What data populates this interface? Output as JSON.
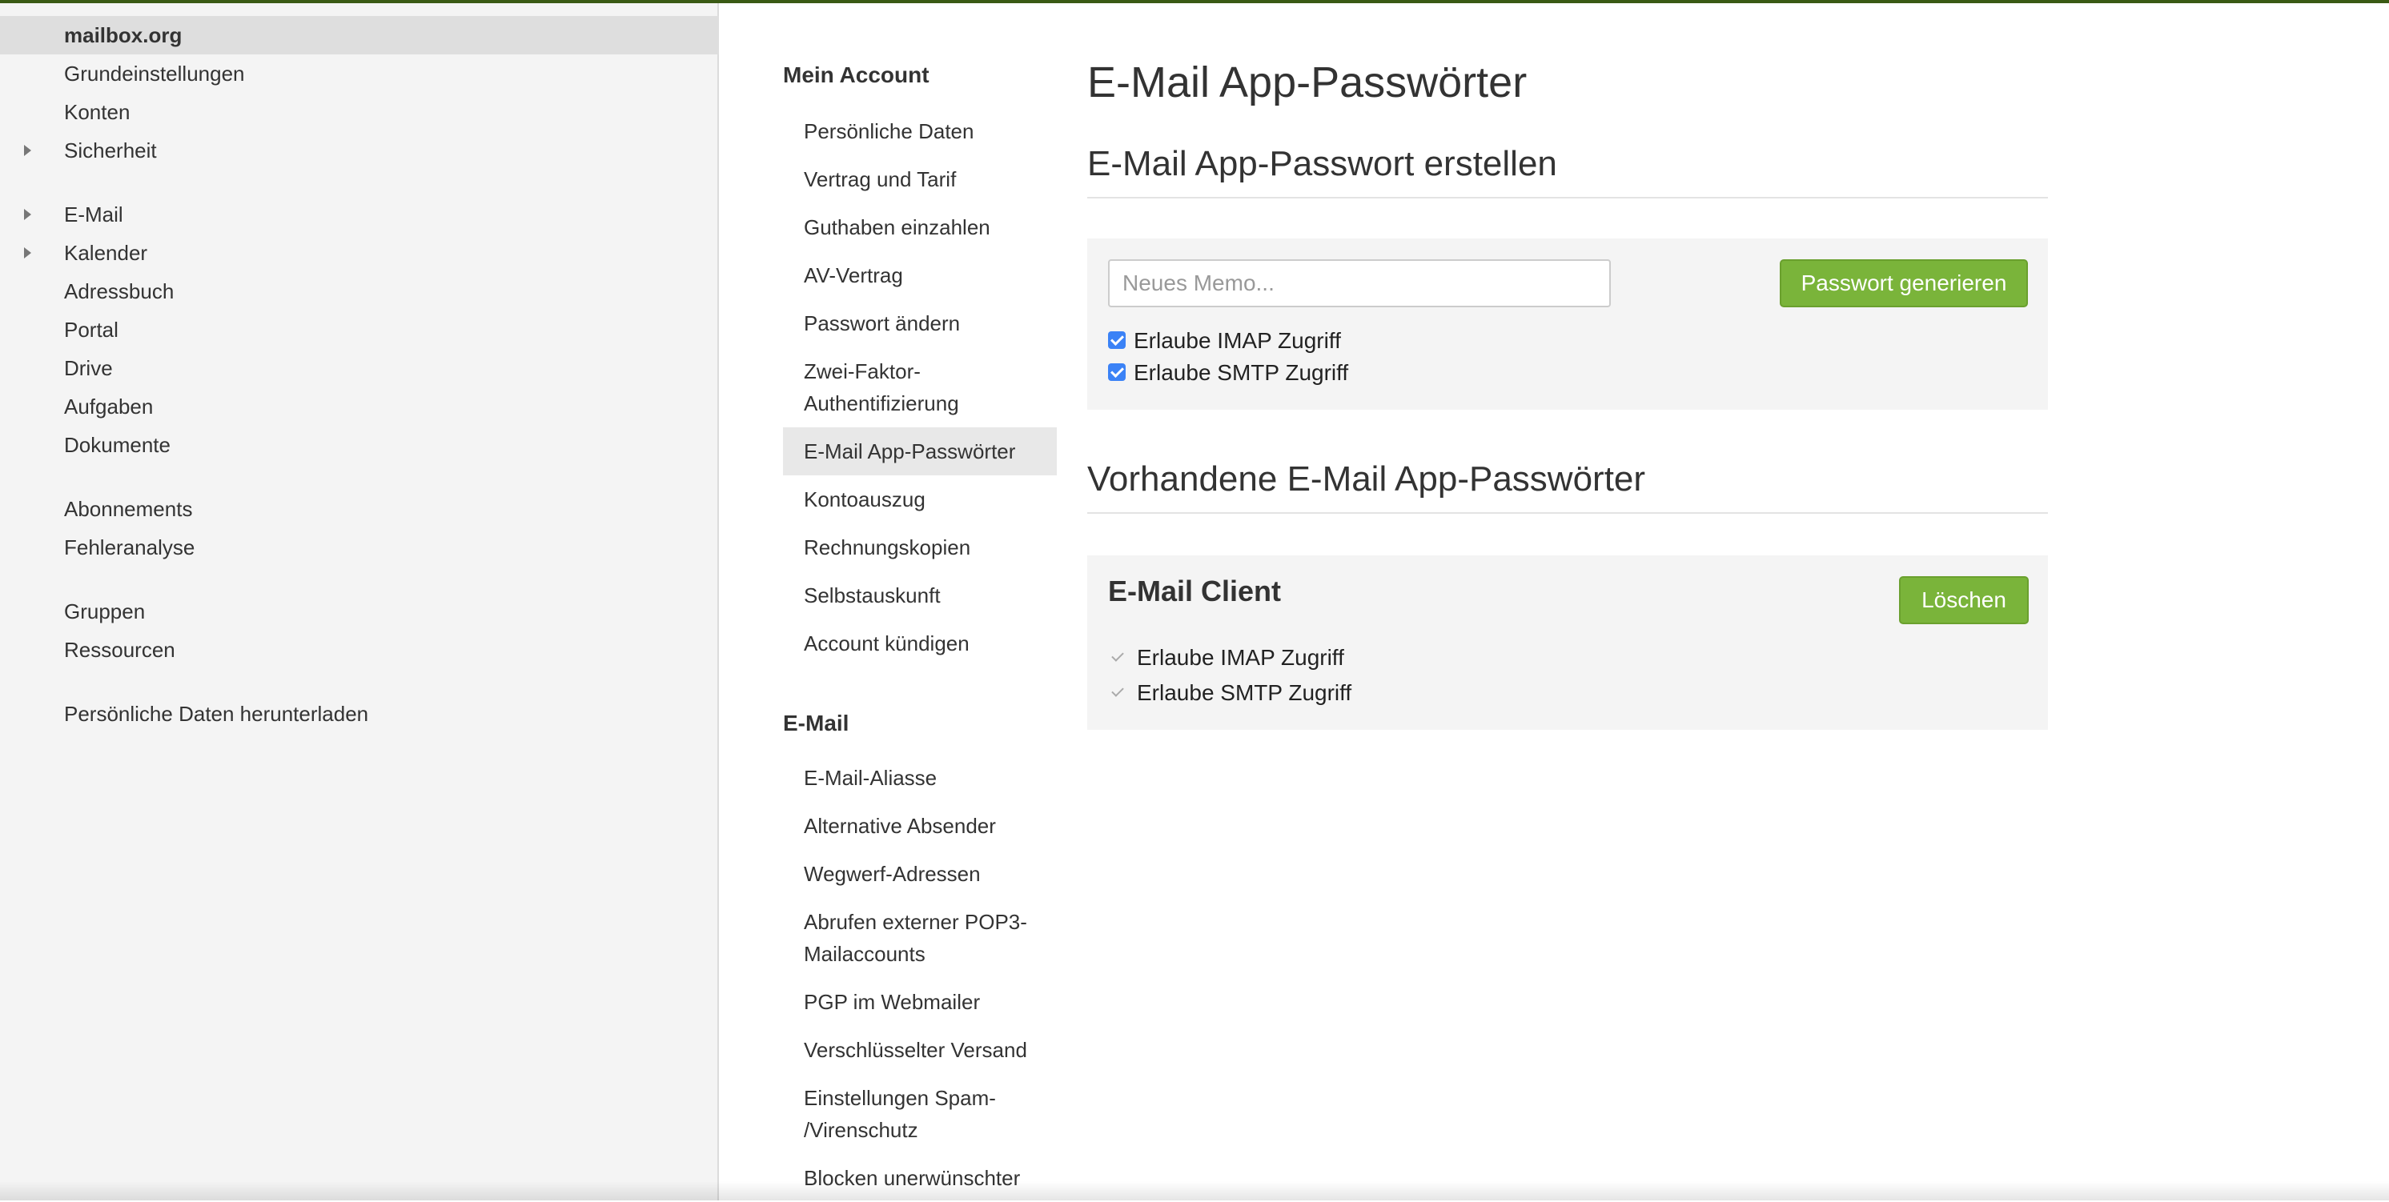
{
  "colors": {
    "accent_green": "#7ab43a",
    "checkbox_blue": "#3b82f6",
    "sidebar_bg": "#f4f4f4"
  },
  "sidebar": {
    "items": [
      {
        "label": "mailbox.org",
        "active": true,
        "expandable": false
      },
      {
        "label": "Grundeinstellungen",
        "expandable": false
      },
      {
        "label": "Konten",
        "expandable": false
      },
      {
        "label": "Sicherheit",
        "expandable": true,
        "icon": "caret-right-icon"
      },
      {
        "label": "E-Mail",
        "expandable": true,
        "icon": "caret-right-icon"
      },
      {
        "label": "Kalender",
        "expandable": true,
        "icon": "caret-right-icon"
      },
      {
        "label": "Adressbuch",
        "expandable": false
      },
      {
        "label": "Portal",
        "expandable": false
      },
      {
        "label": "Drive",
        "expandable": false
      },
      {
        "label": "Aufgaben",
        "expandable": false
      },
      {
        "label": "Dokumente",
        "expandable": false
      },
      {
        "label": "Abonnements",
        "expandable": false
      },
      {
        "label": "Fehleranalyse",
        "expandable": false
      },
      {
        "label": "Gruppen",
        "expandable": false
      },
      {
        "label": "Ressourcen",
        "expandable": false
      },
      {
        "label": "Persönliche Daten herunterladen",
        "expandable": false
      }
    ]
  },
  "nav": {
    "account_heading": "Mein Account",
    "account_items": [
      "Persönliche Daten",
      "Vertrag und Tarif",
      "Guthaben einzahlen",
      "AV-Vertrag",
      "Passwort ändern",
      [
        "Zwei-Faktor-",
        "Authentifizierung"
      ],
      "E-Mail App-Passwörter",
      "Kontoauszug",
      "Rechnungskopien",
      "Selbstauskunft",
      "Account kündigen"
    ],
    "active_item": "E-Mail App-Passwörter",
    "email_heading": "E-Mail",
    "email_items": [
      "E-Mail-Aliasse",
      "Alternative Absender",
      "Wegwerf-Adressen",
      [
        "Abrufen externer POP3-",
        "Mailaccounts"
      ],
      "PGP im Webmailer",
      "Verschlüsselter Versand",
      [
        "Einstellungen Spam-",
        "/Virenschutz"
      ],
      "Blocken unerwünschter"
    ]
  },
  "main": {
    "page_title": "E-Mail App-Passwörter",
    "create_section": {
      "title": "E-Mail App-Passwort erstellen",
      "memo_placeholder": "Neues Memo...",
      "memo_value": "",
      "generate_button": "Passwort generieren",
      "imap_label": "Erlaube IMAP Zugriff",
      "imap_checked": true,
      "smtp_label": "Erlaube SMTP Zugriff",
      "smtp_checked": true
    },
    "existing_section": {
      "title": "Vorhandene E-Mail App-Passwörter",
      "cards": [
        {
          "name": "E-Mail Client",
          "delete_button": "Löschen",
          "imap_label": "Erlaube IMAP Zugriff",
          "imap_allowed": true,
          "smtp_label": "Erlaube SMTP Zugriff",
          "smtp_allowed": true
        }
      ]
    }
  }
}
